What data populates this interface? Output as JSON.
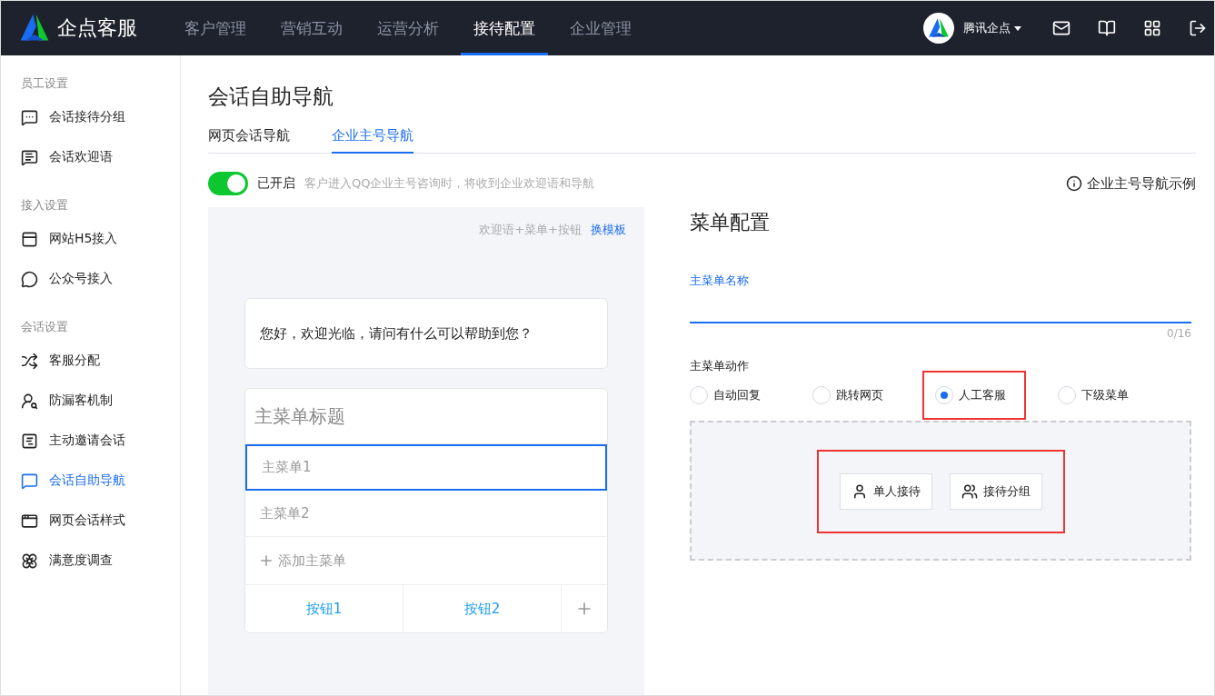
{
  "header": {
    "brand": "企点客服",
    "nav": [
      {
        "label": "客户管理",
        "selected": false
      },
      {
        "label": "营销互动",
        "selected": false
      },
      {
        "label": "运营分析",
        "selected": false
      },
      {
        "label": "接待配置",
        "selected": true
      },
      {
        "label": "企业管理",
        "selected": false
      }
    ],
    "account": "腾讯企点"
  },
  "sidebar": {
    "groups": [
      {
        "title": "员工设置",
        "items": [
          {
            "label": "会话接待分组",
            "selected": false
          },
          {
            "label": "会话欢迎语",
            "selected": false
          }
        ]
      },
      {
        "title": "接入设置",
        "items": [
          {
            "label": "网站H5接入",
            "selected": false
          },
          {
            "label": "公众号接入",
            "selected": false
          }
        ]
      },
      {
        "title": "会话设置",
        "items": [
          {
            "label": "客服分配",
            "selected": false
          },
          {
            "label": "防漏客机制",
            "selected": false
          },
          {
            "label": "主动邀请会话",
            "selected": false
          },
          {
            "label": "会话自助导航",
            "selected": true
          },
          {
            "label": "网页会话样式",
            "selected": false
          },
          {
            "label": "满意度调查",
            "selected": false
          }
        ]
      }
    ]
  },
  "page": {
    "title": "会话自助导航",
    "tabs": [
      {
        "label": "网页会话导航",
        "selected": false
      },
      {
        "label": "企业主号导航",
        "selected": true
      }
    ],
    "toggle": {
      "on": true,
      "label": "已开启",
      "hint": "客户进入QQ企业主号咨询时，将收到企业欢迎语和导航"
    },
    "example_link": "企业主号导航示例"
  },
  "preview": {
    "template": "欢迎语+菜单+按钮",
    "change_template": "换模板",
    "welcome": "您好，欢迎光临，请问有什么可以帮助到您？",
    "menu_title": "主菜单标题",
    "menus": [
      {
        "label": "主菜单1",
        "selected": true
      },
      {
        "label": "主菜单2",
        "selected": false
      }
    ],
    "add_menu": "添加主菜单",
    "buttons": [
      "按钮1",
      "按钮2"
    ]
  },
  "config": {
    "title": "菜单配置",
    "name_label": "主菜单名称",
    "name_counter": "0/16",
    "action_label": "主菜单动作",
    "actions": [
      {
        "label": "自动回复",
        "selected": false,
        "highlighted": false
      },
      {
        "label": "跳转网页",
        "selected": false,
        "highlighted": false
      },
      {
        "label": "人工客服",
        "selected": true,
        "highlighted": true
      },
      {
        "label": "下级菜单",
        "selected": false,
        "highlighted": false
      }
    ],
    "modes_highlighted": true,
    "modes": [
      {
        "kind": "single",
        "label": "单人接待"
      },
      {
        "kind": "group",
        "label": "接待分组"
      }
    ]
  }
}
